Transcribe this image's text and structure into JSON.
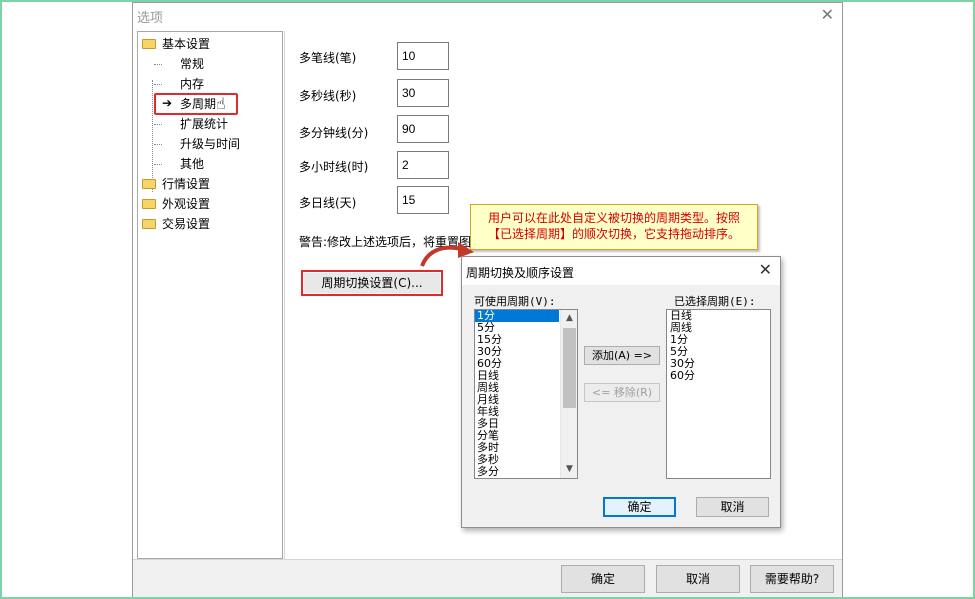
{
  "main_dialog": {
    "title": "选项",
    "close_glyph": "✕",
    "tree": {
      "groups": [
        {
          "label": "基本设置",
          "icon": "folder-open-icon"
        },
        {
          "label": "行情设置",
          "icon": "folder-icon"
        },
        {
          "label": "外观设置",
          "icon": "folder-icon"
        },
        {
          "label": "交易设置",
          "icon": "folder-icon"
        }
      ],
      "children": [
        "常规",
        "内存",
        "多周期",
        "扩展统计",
        "升级与时间",
        "其他"
      ],
      "selected": "多周期",
      "selected_marker": "➔",
      "cursor_glyph": "☝"
    },
    "fields": [
      {
        "label": "多笔线(笔)",
        "value": "10"
      },
      {
        "label": "多秒线(秒)",
        "value": "30"
      },
      {
        "label": "多分钟线(分)",
        "value": "90"
      },
      {
        "label": "多小时线(时)",
        "value": "2"
      },
      {
        "label": "多日线(天)",
        "value": "15"
      }
    ],
    "warning": "警告:修改上述选项后，将重置图",
    "period_button": "周期切换设置(C)...",
    "buttons": {
      "ok": "确定",
      "cancel": "取消",
      "help": "需要帮助?"
    }
  },
  "tooltip": {
    "line1": "用户可以在此处自定义被切换的周期类型。按照",
    "line2": "【已选择周期】的顺次切换，它支持拖动排序。",
    "border_color": "#d9a126",
    "text_color": "#d40000"
  },
  "sub_dialog": {
    "title": "周期切换及顺序设置",
    "close_glyph": "✕",
    "available_label": "可使用周期(V):",
    "available": [
      "1分",
      "5分",
      "15分",
      "30分",
      "60分",
      "日线",
      "周线",
      "月线",
      "年线",
      "多日",
      "分笔",
      "多时",
      "多秒",
      "多分"
    ],
    "available_selected": "1分",
    "selected_label": "已选择周期(E):",
    "selected": [
      "日线",
      "周线",
      "1分",
      "5分",
      "30分",
      "60分"
    ],
    "add_button": "添加(A) =>",
    "remove_button": "<= 移除(R)",
    "ok": "确定",
    "cancel": "取消",
    "scroll_up": "▲",
    "scroll_down": "▼"
  }
}
